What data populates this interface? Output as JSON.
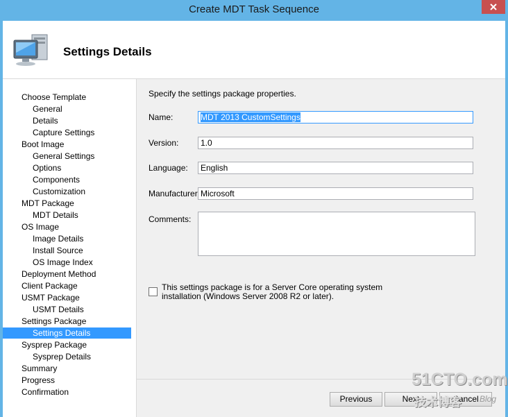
{
  "window": {
    "title": "Create MDT Task Sequence",
    "close_glyph": "✕",
    "accent": "#63b4e6",
    "close_color": "#c75050"
  },
  "header": {
    "title": "Settings Details",
    "icon": "computer-icon"
  },
  "nav": {
    "items": [
      {
        "label": "Choose Template",
        "level": 1
      },
      {
        "label": "General",
        "level": 2
      },
      {
        "label": "Details",
        "level": 2
      },
      {
        "label": "Capture Settings",
        "level": 2
      },
      {
        "label": "Boot Image",
        "level": 1
      },
      {
        "label": "General Settings",
        "level": 2
      },
      {
        "label": "Options",
        "level": 2
      },
      {
        "label": "Components",
        "level": 2
      },
      {
        "label": "Customization",
        "level": 2
      },
      {
        "label": "MDT Package",
        "level": 1
      },
      {
        "label": "MDT Details",
        "level": 2
      },
      {
        "label": "OS Image",
        "level": 1
      },
      {
        "label": "Image Details",
        "level": 2
      },
      {
        "label": "Install Source",
        "level": 2
      },
      {
        "label": "OS Image Index",
        "level": 2
      },
      {
        "label": "Deployment Method",
        "level": 1
      },
      {
        "label": "Client Package",
        "level": 1
      },
      {
        "label": "USMT Package",
        "level": 1
      },
      {
        "label": "USMT Details",
        "level": 2
      },
      {
        "label": "Settings Package",
        "level": 1
      },
      {
        "label": "Settings Details",
        "level": 2,
        "selected": true
      },
      {
        "label": "Sysprep Package",
        "level": 1
      },
      {
        "label": "Sysprep Details",
        "level": 2
      },
      {
        "label": "Summary",
        "level": 1
      },
      {
        "label": "Progress",
        "level": 1
      },
      {
        "label": "Confirmation",
        "level": 1
      }
    ],
    "selected_color": "#3399ff"
  },
  "form": {
    "prompt": "Specify the settings package properties.",
    "name_label": "Name:",
    "name_value": "MDT 2013 CustomSettings",
    "version_label": "Version:",
    "version_value": "1.0",
    "language_label": "Language:",
    "language_value": "English",
    "manufacturer_label": "Manufacturer:",
    "manufacturer_value": "Microsoft",
    "comments_label": "Comments:",
    "comments_value": "",
    "servercore_label": "This settings package is for a Server Core operating system installation (Windows Server 2008 R2 or later).",
    "servercore_checked": false
  },
  "buttons": {
    "previous": "Previous",
    "next": "Next",
    "cancel": "Cancel"
  },
  "watermark": {
    "text_big": "51CTO.com",
    "text_small": "技术博客",
    "text_blog": "Blog"
  }
}
